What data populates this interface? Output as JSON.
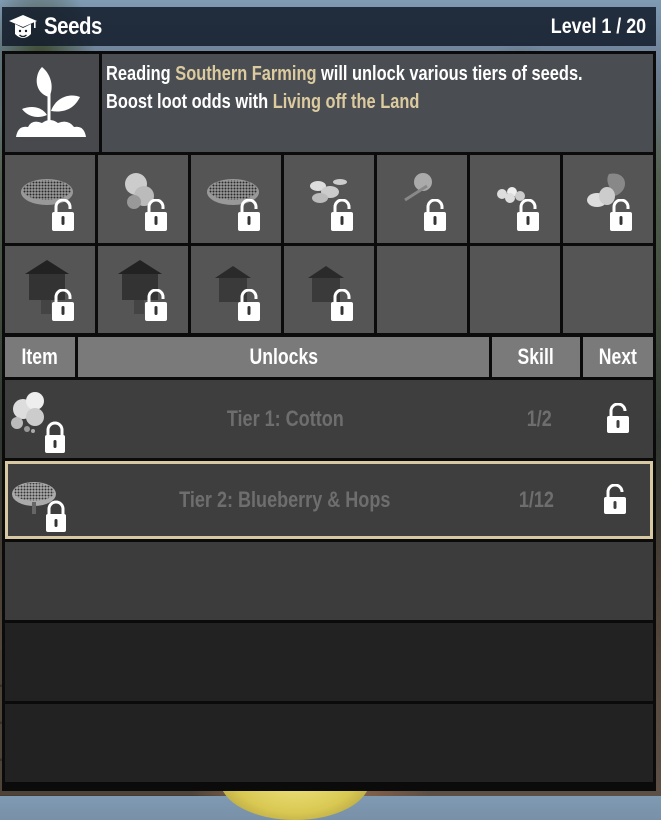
{
  "header": {
    "icon": "graduation-cap-student-icon",
    "title": "Seeds",
    "level": "Level 1 / 20"
  },
  "info": {
    "icon": "sprout-plant-icon",
    "line1_pre": "Reading ",
    "line1_book": "Southern Farming",
    "line1_post": " will unlock various tiers of seeds.",
    "line2_pre": "Boost loot odds with ",
    "line2_perk": "Living off the Land",
    "highlight_color": "#dccb9f"
  },
  "grid": {
    "items": [
      {
        "name": "seed-pile-1",
        "locked": true
      },
      {
        "name": "seed-mushroom",
        "locked": true
      },
      {
        "name": "seed-pile-2",
        "locked": true
      },
      {
        "name": "seed-pumpkin",
        "locked": true
      },
      {
        "name": "seed-aloe-basket",
        "locked": true
      },
      {
        "name": "seed-potato-pieces",
        "locked": true
      },
      {
        "name": "seed-potato-plant",
        "locked": true
      },
      {
        "name": "beehive-1",
        "locked": true
      },
      {
        "name": "beehive-2",
        "locked": true
      },
      {
        "name": "beehive-3",
        "locked": true
      },
      {
        "name": "beehive-4",
        "locked": true
      },
      {
        "name": "empty",
        "locked": false
      },
      {
        "name": "empty",
        "locked": false
      },
      {
        "name": "empty",
        "locked": false
      }
    ]
  },
  "table": {
    "columns": [
      "Item",
      "Unlocks",
      "Skill",
      "Next"
    ],
    "rows": [
      {
        "icon": "cotton-icon",
        "unlocks": "Tier 1: Cotton",
        "skill": "1/2",
        "next_icon": "unlocked-padlock-icon",
        "selected": false
      },
      {
        "icon": "blueberry-bush-icon",
        "unlocks": "Tier 2: Blueberry & Hops",
        "skill": "1/12",
        "next_icon": "unlocked-padlock-icon",
        "selected": true
      }
    ]
  },
  "colors": {
    "selected_border": "#d8c9a2",
    "title_bar": "#141e2c",
    "header_cell": "#7a7a7a"
  }
}
